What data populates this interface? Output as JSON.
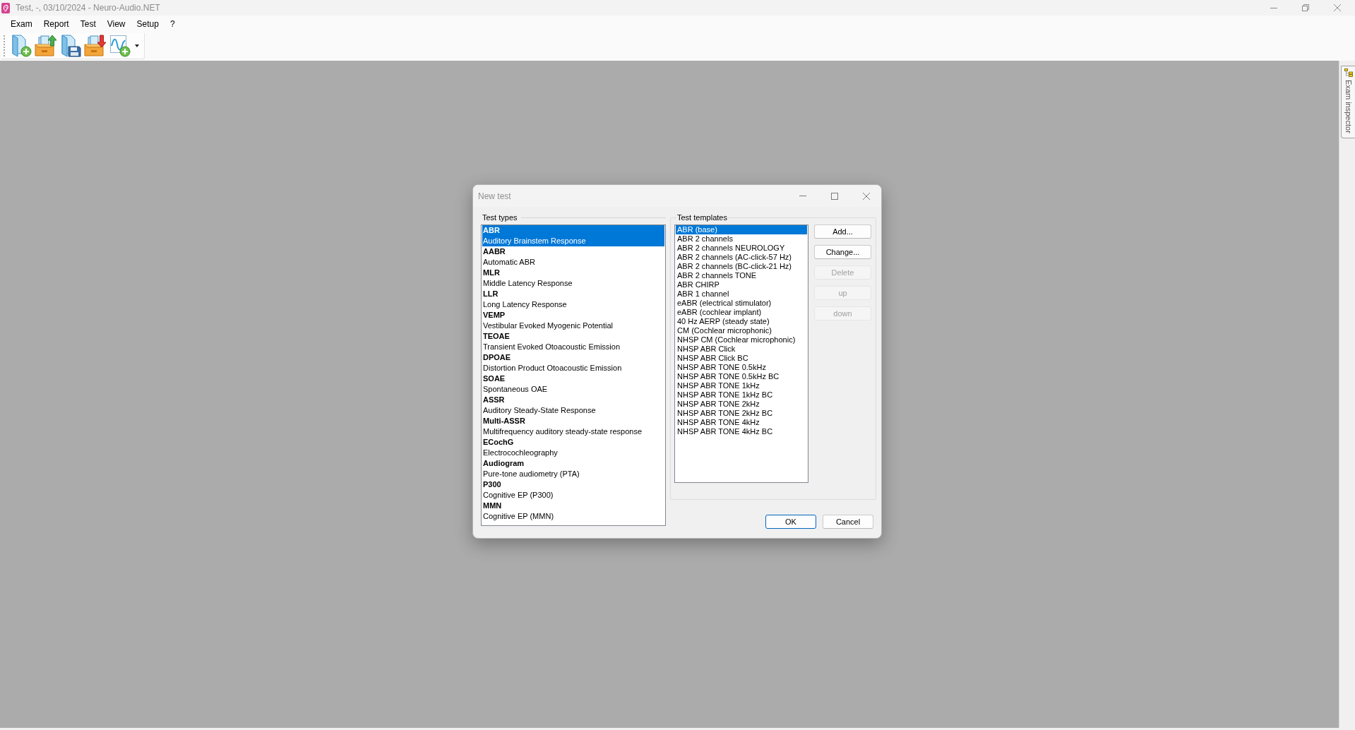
{
  "window": {
    "title": "Test, -, 03/10/2024 - Neuro-Audio.NET"
  },
  "menu": [
    "Exam",
    "Report",
    "Test",
    "View",
    "Setup",
    "?"
  ],
  "side_panel": {
    "tab": "Exam inspector"
  },
  "dialog": {
    "title": "New test",
    "test_types": {
      "label": "Test types",
      "items": [
        {
          "name": "ABR",
          "description": "Auditory Brainstem Response",
          "selected": true
        },
        {
          "name": "AABR",
          "description": "Automatic ABR",
          "selected": false
        },
        {
          "name": "MLR",
          "description": "Middle Latency Response",
          "selected": false
        },
        {
          "name": "LLR",
          "description": "Long Latency Response",
          "selected": false
        },
        {
          "name": "VEMP",
          "description": "Vestibular Evoked Myogenic Potential",
          "selected": false
        },
        {
          "name": "TEOAE",
          "description": "Transient Evoked Otoacoustic Emission",
          "selected": false
        },
        {
          "name": "DPOAE",
          "description": "Distortion Product Otoacoustic Emission",
          "selected": false
        },
        {
          "name": "SOAE",
          "description": "Spontaneous OAE",
          "selected": false
        },
        {
          "name": "ASSR",
          "description": "Auditory Steady-State Response",
          "selected": false
        },
        {
          "name": "Multi-ASSR",
          "description": "Multifrequency auditory steady-state response",
          "selected": false
        },
        {
          "name": "ECochG",
          "description": "Electrocochleography",
          "selected": false
        },
        {
          "name": "Audiogram",
          "description": "Pure-tone audiometry (PTA)",
          "selected": false
        },
        {
          "name": "P300",
          "description": "Cognitive EP (P300)",
          "selected": false
        },
        {
          "name": "MMN",
          "description": "Cognitive EP (MMN)",
          "selected": false
        }
      ]
    },
    "test_templates": {
      "label": "Test templates",
      "items": [
        {
          "label": "ABR (base)",
          "selected": true
        },
        {
          "label": "ABR 2 channels",
          "selected": false
        },
        {
          "label": "ABR 2 channels NEUROLOGY",
          "selected": false
        },
        {
          "label": "ABR 2 channels (AC-click-57 Hz)",
          "selected": false
        },
        {
          "label": "ABR 2 channels (BC-click-21 Hz)",
          "selected": false
        },
        {
          "label": "ABR 2 channels TONE",
          "selected": false
        },
        {
          "label": "ABR CHIRP",
          "selected": false
        },
        {
          "label": "ABR 1 channel",
          "selected": false
        },
        {
          "label": "eABR (electrical stimulator)",
          "selected": false
        },
        {
          "label": "eABR (cochlear implant)",
          "selected": false
        },
        {
          "label": "40 Hz AERP (steady state)",
          "selected": false
        },
        {
          "label": "CM (Cochlear microphonic)",
          "selected": false
        },
        {
          "label": "NHSP CM (Cochlear microphonic)",
          "selected": false
        },
        {
          "label": "NHSP ABR Click",
          "selected": false
        },
        {
          "label": "NHSP ABR Click BC",
          "selected": false
        },
        {
          "label": "NHSP ABR TONE 0.5kHz",
          "selected": false
        },
        {
          "label": "NHSP ABR TONE 0.5kHz BC",
          "selected": false
        },
        {
          "label": "NHSP ABR TONE 1kHz",
          "selected": false
        },
        {
          "label": "NHSP ABR TONE 1kHz BC",
          "selected": false
        },
        {
          "label": "NHSP ABR TONE 2kHz",
          "selected": false
        },
        {
          "label": "NHSP ABR TONE 2kHz BC",
          "selected": false
        },
        {
          "label": "NHSP ABR TONE 4kHz",
          "selected": false
        },
        {
          "label": "NHSP ABR TONE 4kHz BC",
          "selected": false
        }
      ]
    },
    "side_buttons": [
      {
        "label": "Add...",
        "disabled": false
      },
      {
        "label": "Change...",
        "disabled": false
      },
      {
        "label": "Delete",
        "disabled": true
      },
      {
        "label": "up",
        "disabled": true
      },
      {
        "label": "down",
        "disabled": true
      }
    ],
    "buttons": [
      {
        "label": "OK",
        "default": true
      },
      {
        "label": "Cancel",
        "default": false
      }
    ]
  }
}
